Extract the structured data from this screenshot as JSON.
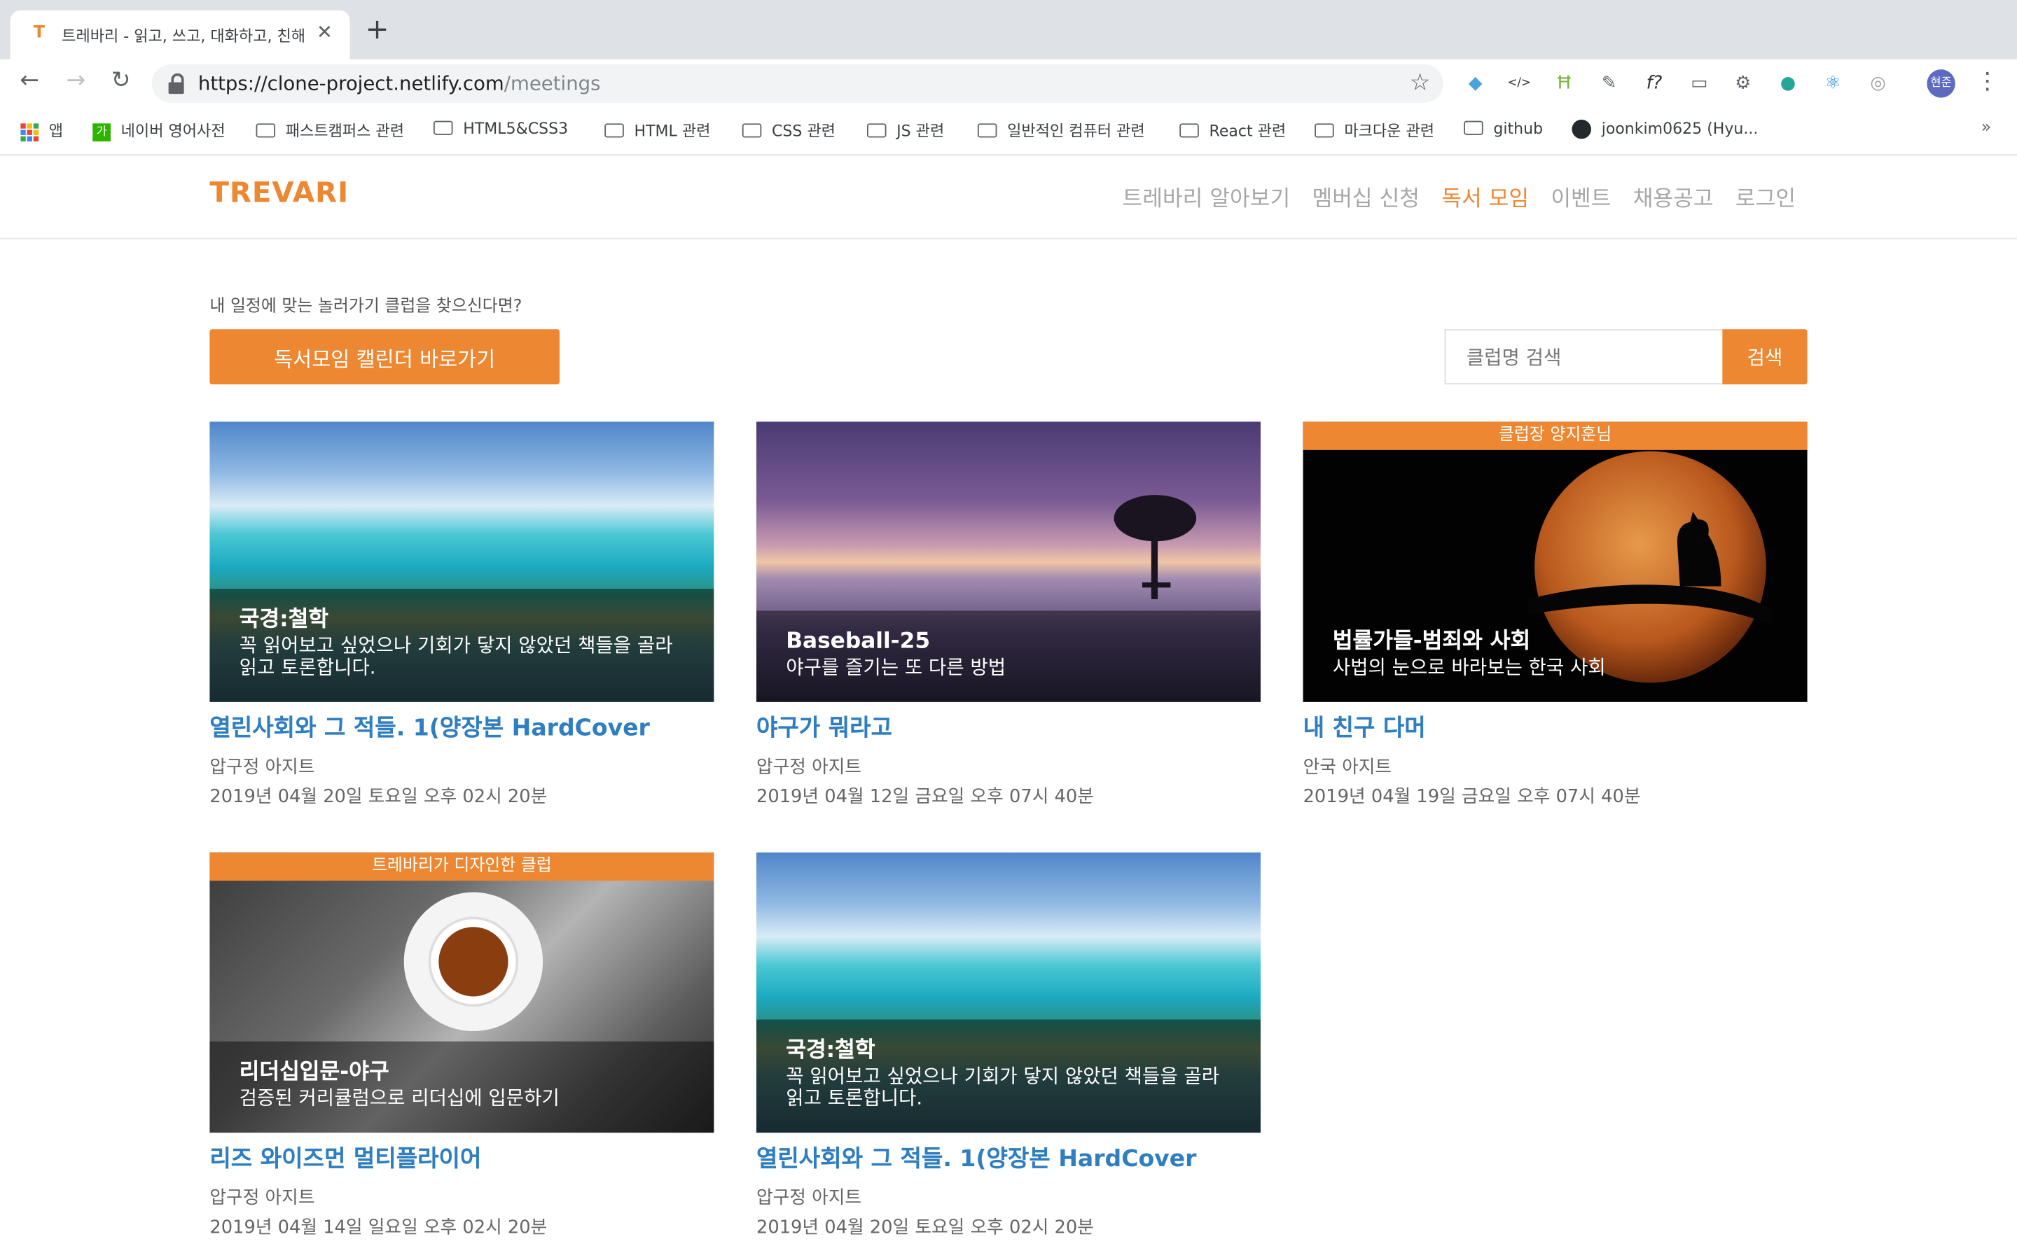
{
  "browser": {
    "tab_title": "트레바리 - 읽고, 쓰고, 대화하고, 친해",
    "tab_favicon": "T",
    "url_host": "https://clone-project.netlify.com",
    "url_path": "/meetings",
    "profile_initials": "현준",
    "bookmarks": [
      {
        "label": "앱",
        "icon": "apps-icon"
      },
      {
        "label": "네이버 영어사전",
        "icon": "naver-icon"
      },
      {
        "label": "패스트캠퍼스 관련",
        "icon": "folder-icon"
      },
      {
        "label": "HTML5&CSS3",
        "icon": "folder-icon"
      },
      {
        "label": "HTML 관련",
        "icon": "folder-icon"
      },
      {
        "label": "CSS 관련",
        "icon": "folder-icon"
      },
      {
        "label": "JS 관련",
        "icon": "folder-icon"
      },
      {
        "label": "일반적인 컴퓨터 관련",
        "icon": "folder-icon"
      },
      {
        "label": "React 관련",
        "icon": "folder-icon"
      },
      {
        "label": "마크다운 관련",
        "icon": "folder-icon"
      },
      {
        "label": "github",
        "icon": "folder-icon"
      },
      {
        "label": "joonkim0625 (Hyu...",
        "icon": "github-icon"
      }
    ],
    "bookmarks_more": "»"
  },
  "header": {
    "logo": "TREVARI",
    "nav": [
      {
        "label": "트레바리 알아보기",
        "active": false
      },
      {
        "label": "멤버십 신청",
        "active": false
      },
      {
        "label": "독서 모임",
        "active": true
      },
      {
        "label": "이벤트",
        "active": false
      },
      {
        "label": "채용공고",
        "active": false
      },
      {
        "label": "로그인",
        "active": false
      }
    ]
  },
  "promo": {
    "text": "내 일정에 맞는 놀러가기 클럽을 찾으신다면?",
    "calendar_button": "독서모임 캘린더 바로가기"
  },
  "search": {
    "placeholder": "클럽명 검색",
    "button": "검색"
  },
  "colors": {
    "accent": "#ee8732",
    "link": "#2f7ec0"
  },
  "cards": [
    {
      "badge": "",
      "scene": "beach",
      "club": "국경:철학",
      "desc": "꼭 읽어보고 싶었으나 기회가 닿지 않았던 책들을 골라 읽고 토론합니다.",
      "title": "열린사회와 그 적들. 1(양장본 HardCover",
      "place": "압구정 아지트",
      "date": "2019년 04월 20일 토요일 오후 02시 20분"
    },
    {
      "badge": "",
      "scene": "sunset",
      "club": "Baseball-25",
      "desc": "야구를 즐기는 또 다른 방법",
      "title": "야구가 뭐라고",
      "place": "압구정 아지트",
      "date": "2019년 04월 12일 금요일 오후 07시 40분"
    },
    {
      "badge": "클럽장 양지훈님",
      "scene": "moon",
      "club": "법률가들-범죄와 사회",
      "desc": "사법의 눈으로 바라보는 한국 사회",
      "title": "내 친구 다머",
      "place": "안국 아지트",
      "date": "2019년 04월 19일 금요일 오후 07시 40분"
    },
    {
      "badge": "트레바리가 디자인한 클럽",
      "scene": "tea",
      "club": "리더십입문-야구",
      "desc": "검증된 커리큘럼으로 리더십에 입문하기",
      "title": "리즈 와이즈먼 멀티플라이어",
      "place": "압구정 아지트",
      "date": "2019년 04월 14일 일요일 오후 02시 20분"
    },
    {
      "badge": "",
      "scene": "beach",
      "club": "국경:철학",
      "desc": "꼭 읽어보고 싶었으나 기회가 닿지 않았던 책들을 골라 읽고 토론합니다.",
      "title": "열린사회와 그 적들. 1(양장본 HardCover",
      "place": "압구정 아지트",
      "date": "2019년 04월 20일 토요일 오후 02시 20분"
    }
  ]
}
